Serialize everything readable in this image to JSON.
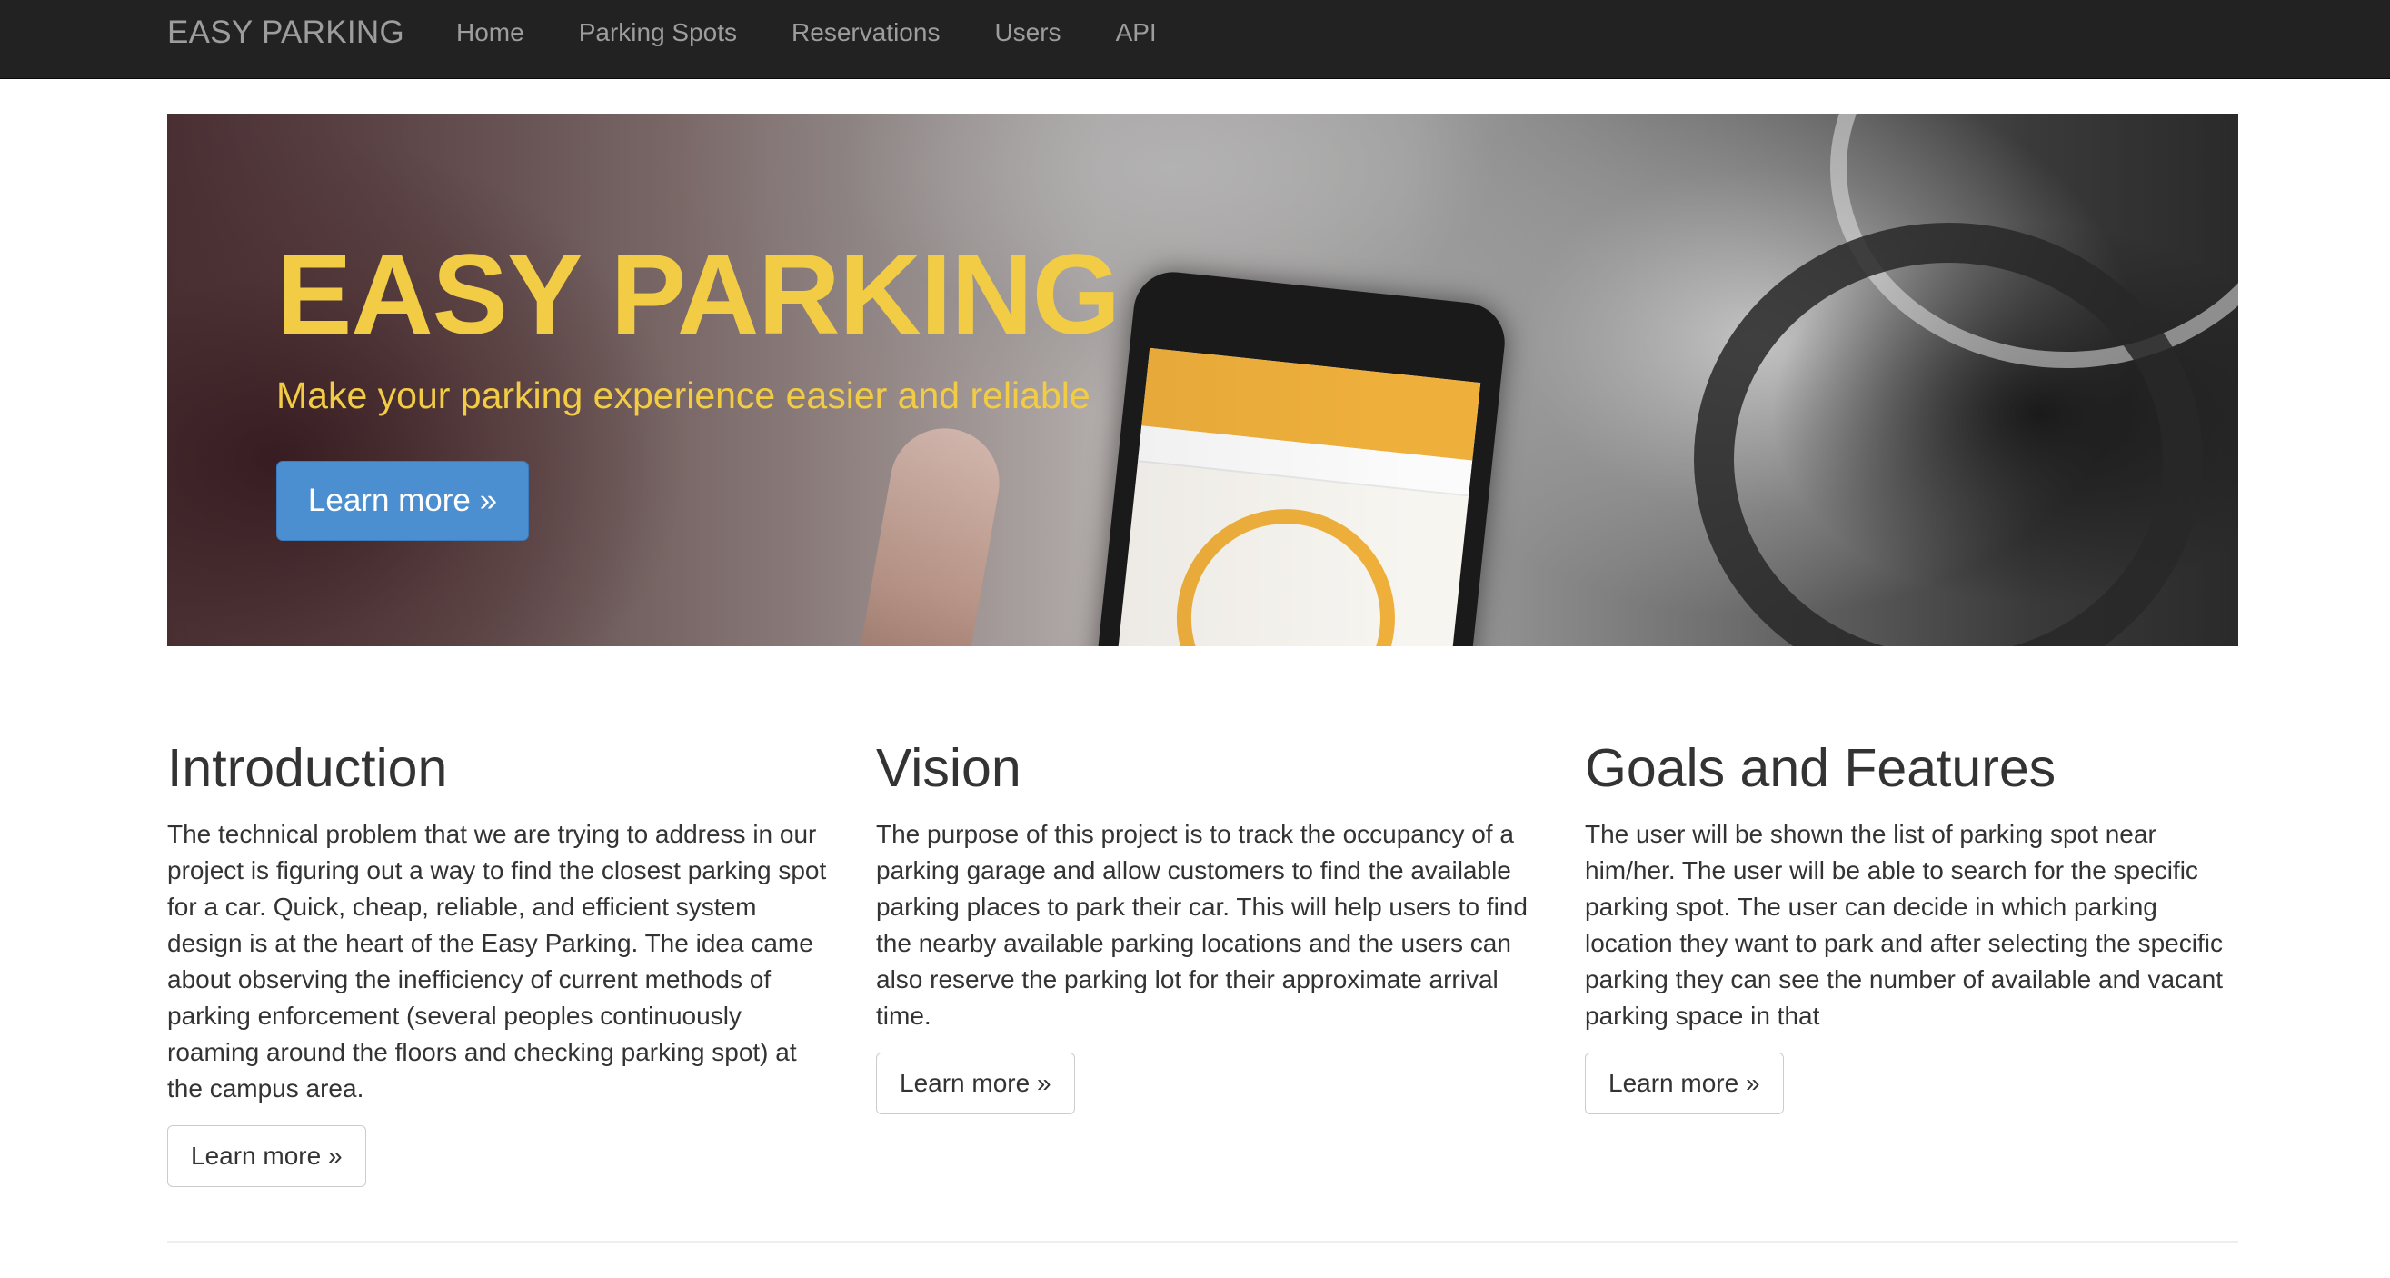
{
  "navbar": {
    "brand": "EASY PARKING",
    "links": [
      "Home",
      "Parking Spots",
      "Reservations",
      "Users",
      "API"
    ]
  },
  "hero": {
    "title": "EASY PARKING",
    "subtitle": "Make your parking experience easier and reliable",
    "button_label": "Learn more »",
    "title_color": "#f2cc45",
    "button_color": "#4c8fd0"
  },
  "columns": [
    {
      "heading": "Introduction",
      "body": "The technical problem that we are trying to address in our project is figuring out a way to find the closest parking spot for a car. Quick, cheap, reliable, and efficient system design is at the heart of the Easy Parking. The idea came about observing the inefficiency of current methods of parking enforcement (several peoples continuously roaming around the floors and checking parking spot) at the campus area.",
      "button_label": "Learn more »"
    },
    {
      "heading": "Vision",
      "body": "The purpose of this project is to track the occupancy of a parking garage and allow customers to find the available parking places to park their car. This will help users to find the nearby available parking locations and the users can also reserve the parking lot for their approximate arrival time.",
      "button_label": "Learn more »"
    },
    {
      "heading": "Goals and Features",
      "body": "The user will be shown the list of parking spot near him/her. The user will be able to search for the specific parking spot. The user can decide in which parking location they want to park and after selecting the specific parking they can see the number of available and vacant parking space in that",
      "button_label": "Learn more »"
    }
  ],
  "colors": {
    "navbar_bg": "#222222",
    "navbar_text": "#9d9d9d",
    "body_text": "#333333"
  }
}
